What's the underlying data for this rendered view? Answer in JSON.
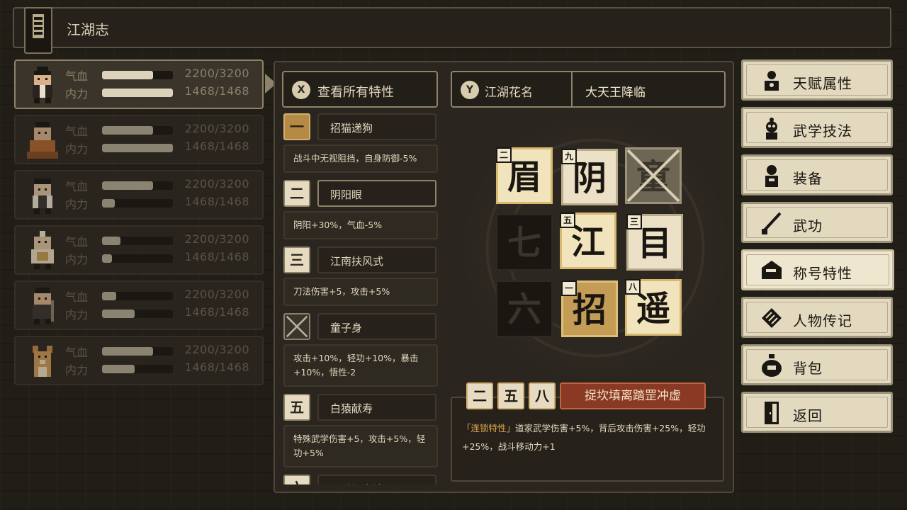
{
  "header": {
    "title": "江湖志"
  },
  "party": [
    {
      "hp_label": "气血",
      "hp_value": "2200/3200",
      "hp_ratio": 0.72,
      "mp_label": "内力",
      "mp_value": "1468/1468",
      "mp_ratio": 1.0,
      "active": true
    },
    {
      "hp_label": "气血",
      "hp_value": "2200/3200",
      "hp_ratio": 0.72,
      "mp_label": "内力",
      "mp_value": "1468/1468",
      "mp_ratio": 1.0
    },
    {
      "hp_label": "气血",
      "hp_value": "2200/3200",
      "hp_ratio": 0.72,
      "mp_label": "内力",
      "mp_value": "1468/1468",
      "mp_ratio": 0.18
    },
    {
      "hp_label": "气血",
      "hp_value": "2200/3200",
      "hp_ratio": 0.26,
      "mp_label": "内力",
      "mp_value": "1468/1468",
      "mp_ratio": 0.14
    },
    {
      "hp_label": "气血",
      "hp_value": "2200/3200",
      "hp_ratio": 0.2,
      "mp_label": "内力",
      "mp_value": "1468/1468",
      "mp_ratio": 0.46
    },
    {
      "hp_label": "气血",
      "hp_value": "2200/3200",
      "hp_ratio": 0.72,
      "mp_label": "内力",
      "mp_value": "1468/1468",
      "mp_ratio": 0.46
    }
  ],
  "traits_panel": {
    "view_all_key": "X",
    "view_all_label": "查看所有特性",
    "items": [
      {
        "num": "一",
        "name": "招猫递狗",
        "desc": "战斗中无视阻挡，自身防御-5%"
      },
      {
        "num": "二",
        "name": "阴阳眼",
        "desc": "阴阳+30%，气血-5%"
      },
      {
        "num": "三",
        "name": "江南扶风式",
        "desc": "刀法伤害+5，攻击+5%"
      },
      {
        "num": "",
        "name": "童子身",
        "desc": "攻击+10%，轻功+10%，暴击+10%，悟性-2"
      },
      {
        "num": "五",
        "name": "白猿献寿",
        "desc": "特殊武学伤害+5，攻击+5%，轻功+5%"
      },
      {
        "num": "六",
        "name": "通臂打定法",
        "desc": ""
      }
    ]
  },
  "nickname": {
    "key": "Y",
    "label": "江湖花名",
    "value": "大天王降临"
  },
  "grid": [
    {
      "char": "眉",
      "sub": "二"
    },
    {
      "char": "阴",
      "sub": "九"
    },
    {
      "char": "童",
      "sub": ""
    },
    {
      "char": "七",
      "sub": ""
    },
    {
      "char": "江",
      "sub": "五"
    },
    {
      "char": "目",
      "sub": "三"
    },
    {
      "char": "六",
      "sub": ""
    },
    {
      "char": "招",
      "sub": "一"
    },
    {
      "char": "遥",
      "sub": "八"
    }
  ],
  "combo": {
    "nums": [
      "二",
      "五",
      "八"
    ],
    "name": "捉坎填离踏罡冲虚",
    "desc_tag": "「连锁特性」",
    "desc_text": "道家武学伤害+5%，背后攻击伤害+25%，轻功+25%，战斗移动力+1"
  },
  "menu": [
    {
      "label": "天赋属性",
      "icon": "talent-icon"
    },
    {
      "label": "武学技法",
      "icon": "martial-skill-icon"
    },
    {
      "label": "装备",
      "icon": "equipment-icon"
    },
    {
      "label": "武功",
      "icon": "sword-icon"
    },
    {
      "label": "称号特性",
      "icon": "title-tag-icon",
      "selected": true
    },
    {
      "label": "人物传记",
      "icon": "biography-book-icon"
    },
    {
      "label": "背包",
      "icon": "bag-icon"
    },
    {
      "label": "返回",
      "icon": "exit-door-icon"
    }
  ],
  "colors": {
    "accent": "#d6b86e",
    "combo": "#8a3a24",
    "highlight": "#e2a64e"
  }
}
